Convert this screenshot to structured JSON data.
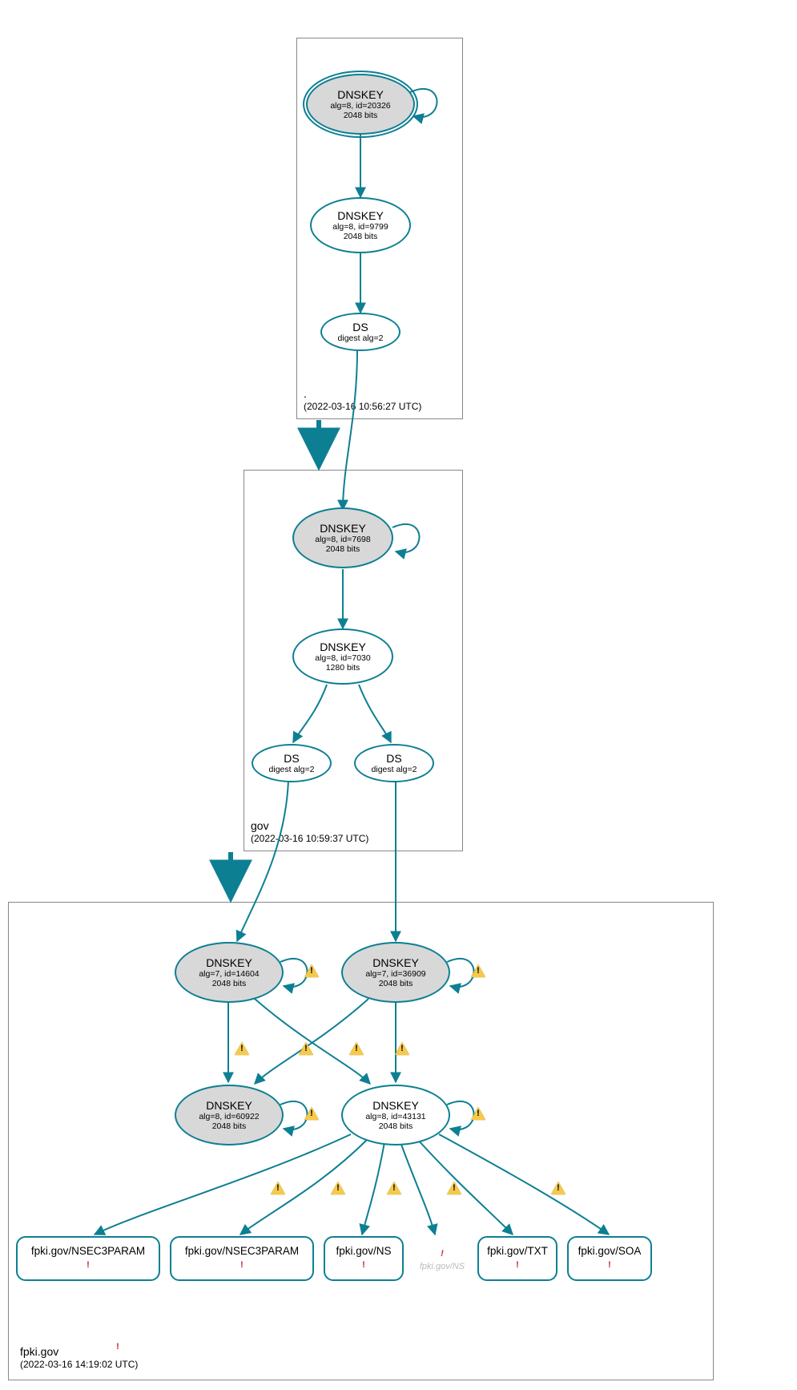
{
  "zones": {
    "root": {
      "name": ".",
      "timestamp": "(2022-03-16 10:56:27 UTC)"
    },
    "gov": {
      "name": "gov",
      "timestamp": "(2022-03-16 10:59:37 UTC)"
    },
    "fpki": {
      "name": "fpki.gov",
      "timestamp": "(2022-03-16 14:19:02 UTC)"
    }
  },
  "nodes": {
    "root_ksk": {
      "title": "DNSKEY",
      "line1": "alg=8, id=20326",
      "line2": "2048 bits"
    },
    "root_zsk": {
      "title": "DNSKEY",
      "line1": "alg=8, id=9799",
      "line2": "2048 bits"
    },
    "root_ds": {
      "title": "DS",
      "line1": "digest alg=2"
    },
    "gov_ksk": {
      "title": "DNSKEY",
      "line1": "alg=8, id=7698",
      "line2": "2048 bits"
    },
    "gov_zsk": {
      "title": "DNSKEY",
      "line1": "alg=8, id=7030",
      "line2": "1280 bits"
    },
    "gov_ds1": {
      "title": "DS",
      "line1": "digest alg=2"
    },
    "gov_ds2": {
      "title": "DS",
      "line1": "digest alg=2"
    },
    "fpki_k1": {
      "title": "DNSKEY",
      "line1": "alg=7, id=14604",
      "line2": "2048 bits"
    },
    "fpki_k2": {
      "title": "DNSKEY",
      "line1": "alg=7, id=36909",
      "line2": "2048 bits"
    },
    "fpki_k3": {
      "title": "DNSKEY",
      "line1": "alg=8, id=60922",
      "line2": "2048 bits"
    },
    "fpki_k4": {
      "title": "DNSKEY",
      "line1": "alg=8, id=43131",
      "line2": "2048 bits"
    }
  },
  "rrsets": {
    "r1": "fpki.gov/NSEC3PARAM",
    "r2": "fpki.gov/NSEC3PARAM",
    "r3": "fpki.gov/NS",
    "r4": "fpki.gov/NS",
    "r5": "fpki.gov/TXT",
    "r6": "fpki.gov/SOA"
  },
  "colors": {
    "teal": "#0d7f93",
    "gray": "#d8d8d8",
    "warn": "#f7c948",
    "err": "#c62828"
  }
}
